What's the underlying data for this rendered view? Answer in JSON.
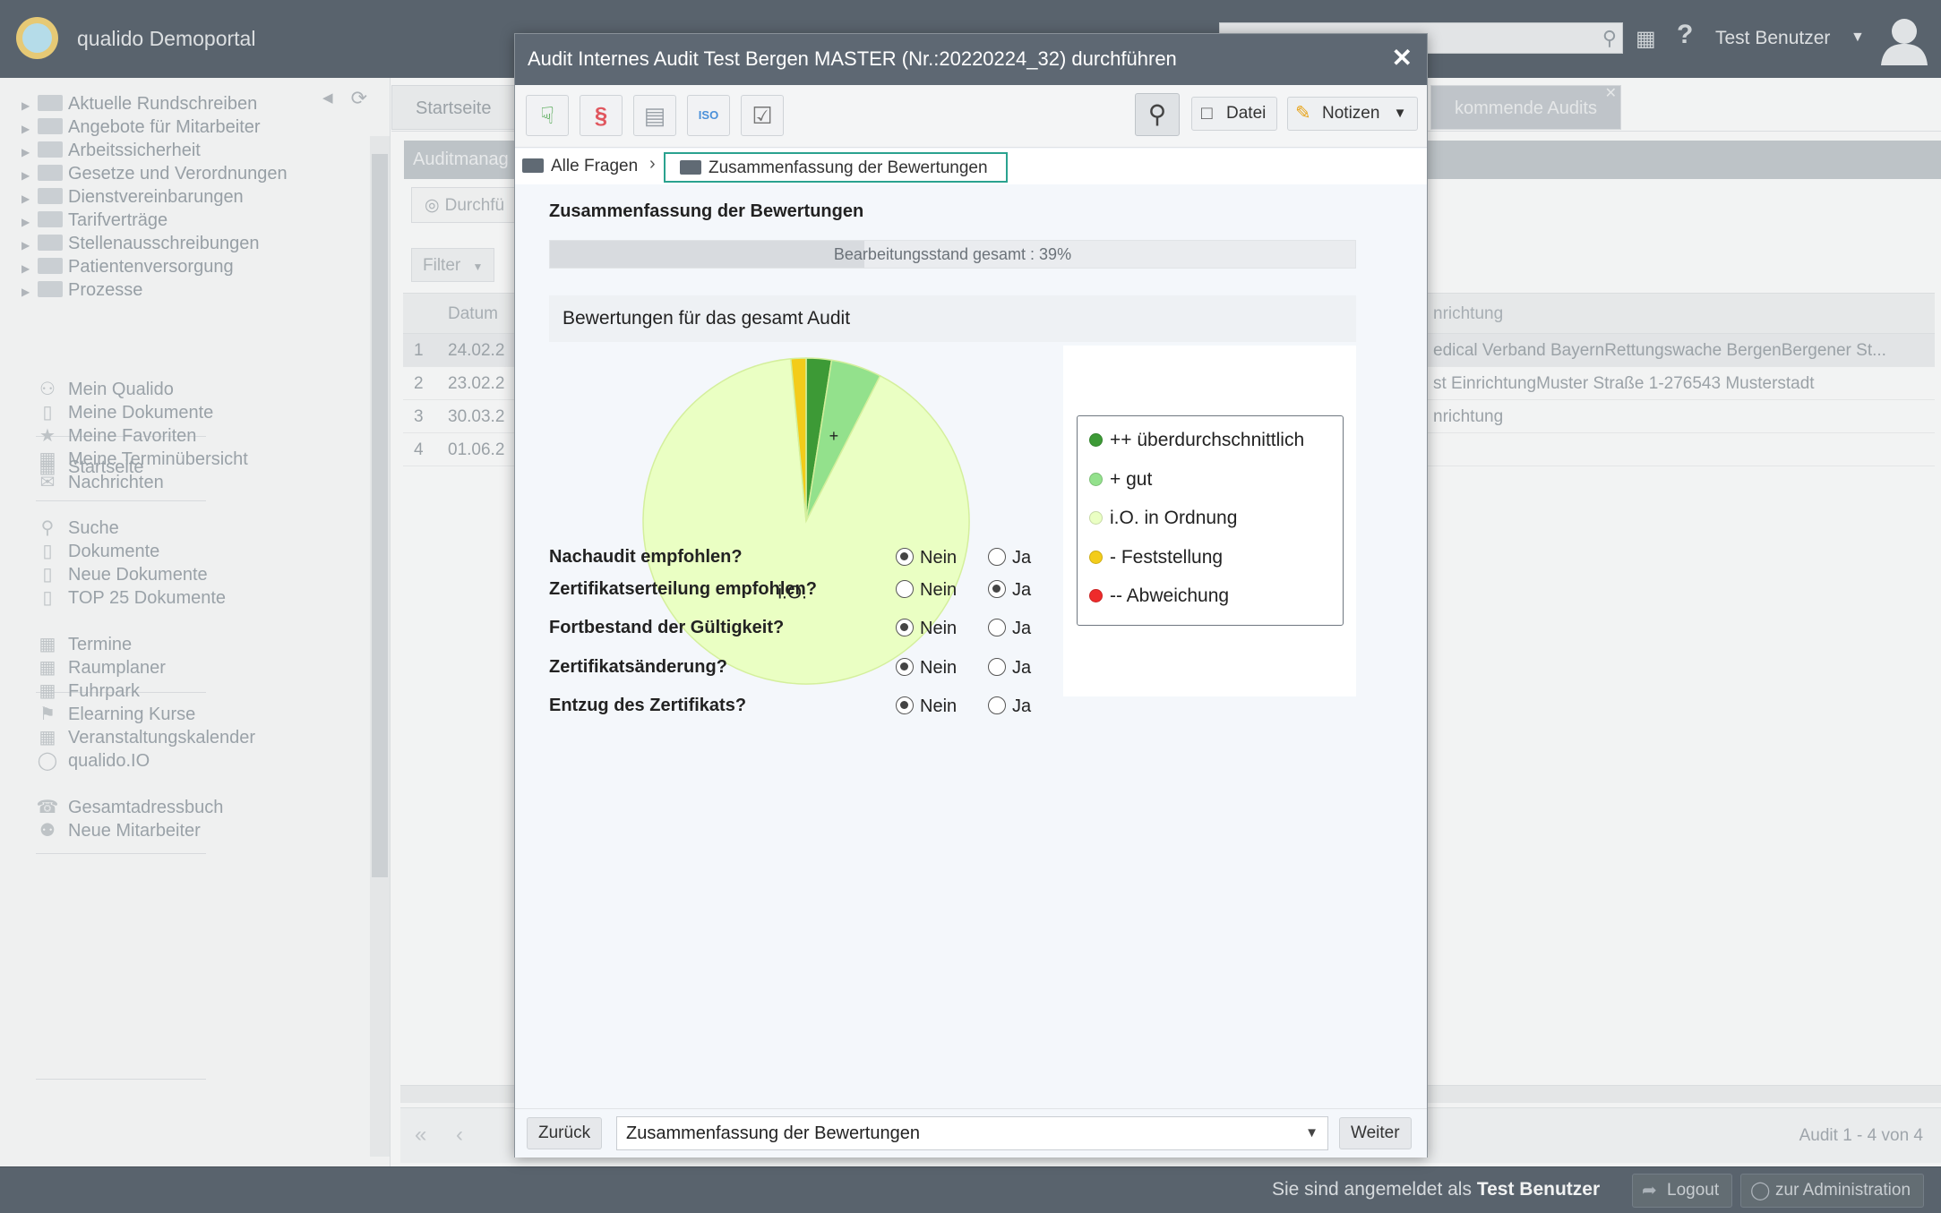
{
  "header": {
    "app_title": "qualido Demoportal",
    "user_name": "Test Benutzer"
  },
  "sidebar": {
    "folders": [
      "Aktuelle Rundschreiben",
      "Angebote für Mitarbeiter",
      "Arbeitssicherheit",
      "Gesetze und Verordnungen",
      "Dienstvereinbarungen",
      "Tarifverträge",
      "Stellenausschreibungen",
      "Patientenversorgung",
      "Prozesse"
    ],
    "startseite": "Startseite",
    "group1": [
      "Mein Qualido",
      "Meine Dokumente",
      "Meine Favoriten",
      "Meine Terminübersicht",
      "Nachrichten"
    ],
    "group2": [
      "Suche",
      "Dokumente",
      "Neue Dokumente",
      "TOP 25 Dokumente"
    ],
    "group3": [
      "Termine",
      "Raumplaner",
      "Fuhrpark",
      "Elearning Kurse",
      "Veranstaltungskalender",
      "qualido.IO"
    ],
    "group4": [
      "Gesamtadressbuch",
      "Neue Mitarbeiter"
    ]
  },
  "background": {
    "tab_home": "Startseite",
    "tab_upcoming": "kommende Audits",
    "section_title": "Auditmanag",
    "button_partial": "Durchfü",
    "filter": "Filter",
    "col_date": "Datum",
    "col_facility": "nrichtung",
    "rows": [
      {
        "num": "1",
        "date": "24.02.2",
        "facility": "edical Verband BayernRettungswache BergenBergener St..."
      },
      {
        "num": "2",
        "date": "23.02.2",
        "facility": "st EinrichtungMuster Straße 1-276543 Musterstadt"
      },
      {
        "num": "3",
        "date": "30.03.2",
        "facility": "nrichtung"
      },
      {
        "num": "4",
        "date": "01.06.2",
        "facility": ""
      }
    ],
    "pager_count": "Audit 1 - 4 von 4"
  },
  "footer": {
    "logged_in_prefix": "Sie sind angemeldet als",
    "logged_in_user": "Test Benutzer",
    "logout": "Logout",
    "admin": "zur Administration"
  },
  "dialog": {
    "title": "Audit Internes Audit Test Bergen MASTER (Nr.:20220224_32) durchführen",
    "toolbar": {
      "datei": "Datei",
      "notizen": "Notizen"
    },
    "breadcrumb": {
      "root": "Alle Fragen",
      "current": "Zusammenfassung der Bewertungen"
    },
    "summary_title": "Zusammenfassung der Bewertungen",
    "progress": {
      "label": "Bearbeitungsstand gesamt : 39%",
      "value": 0.39
    },
    "chart_heading": "Bewertungen für das gesamt Audit",
    "questions": [
      {
        "label": "Nachaudit empfohlen?",
        "no": "Nein",
        "yes": "Ja",
        "selected": "no"
      },
      {
        "label": "Zertifikatserteilung empfohlen?",
        "no": "Nein",
        "yes": "Ja",
        "selected": "yes"
      },
      {
        "label": "Fortbestand der Gültigkeit?",
        "no": "Nein",
        "yes": "Ja",
        "selected": "no"
      },
      {
        "label": "Zertifikatsänderung?",
        "no": "Nein",
        "yes": "Ja",
        "selected": "no"
      },
      {
        "label": "Entzug des Zertifikats?",
        "no": "Nein",
        "yes": "Ja",
        "selected": "no"
      }
    ],
    "footer": {
      "back": "Zurück",
      "step": "Zusammenfassung der Bewertungen",
      "next": "Weiter"
    }
  },
  "chart_data": {
    "type": "pie",
    "title": "Bewertungen für das gesamt Audit",
    "legend_position": "right",
    "slices": [
      {
        "name": "++ überdurchschnittlich",
        "value": 2.5,
        "color": "#3d9a36",
        "label": ""
      },
      {
        "name": "+ gut",
        "value": 5,
        "color": "#93e18c",
        "label": "+"
      },
      {
        "name": "i.O. in Ordnung",
        "value": 91,
        "color": "#eaffc3",
        "label": "i.O."
      },
      {
        "name": "- Feststellung",
        "value": 1.5,
        "color": "#f3cc1a",
        "label": ""
      },
      {
        "name": "-- Abweichung",
        "value": 0,
        "color": "#ee2b2b",
        "label": ""
      }
    ]
  }
}
